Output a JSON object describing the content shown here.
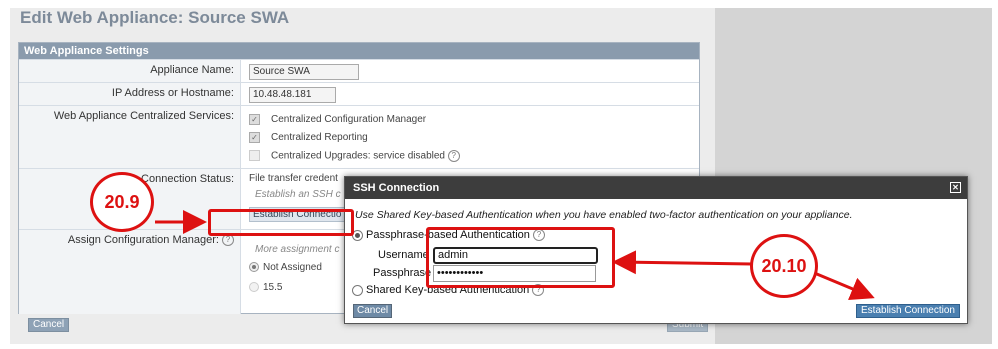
{
  "page": {
    "title": "Edit Web Appliance: Source SWA",
    "cancel_label": "Cancel",
    "submit_label": "Submit"
  },
  "settings": {
    "header": "Web Appliance Settings",
    "appliance_name_label": "Appliance Name:",
    "appliance_name_value": "Source SWA",
    "ip_label": "IP Address or Hostname:",
    "ip_value": "10.48.48.181",
    "services_label": "Web Appliance Centralized Services:",
    "services": [
      {
        "label": "Centralized Configuration Manager",
        "checked": true
      },
      {
        "label": "Centralized Reporting",
        "checked": true
      },
      {
        "label": "Centralized Upgrades: service disabled",
        "checked": false
      }
    ],
    "connection_label": "Connection Status:",
    "connection_text": "File transfer credent",
    "connection_hint": "Establish an SSH c",
    "establish_button": "Establish Connectio",
    "assign_label": "Assign Configuration Manager:",
    "assign_hint": "More assignment c",
    "assign_options": [
      {
        "label": "Not Assigned",
        "selected": true
      },
      {
        "label": "15.5",
        "selected": false
      }
    ]
  },
  "dialog": {
    "title": "SSH Connection",
    "description": "Use Shared Key-based Authentication when you have enabled two-factor authentication on your appliance.",
    "option_passphrase": "Passphrase-based Authentication",
    "username_label": "Username",
    "username_value": "admin",
    "passphrase_label": "Passphrase",
    "passphrase_value": "••••••••••••",
    "option_shared_key": "Shared Key-based Authentication",
    "cancel_label": "Cancel",
    "establish_label": "Establish Connection"
  },
  "annotations": {
    "step_a": "20.9",
    "step_b": "20.10",
    "color": "#d11111"
  }
}
